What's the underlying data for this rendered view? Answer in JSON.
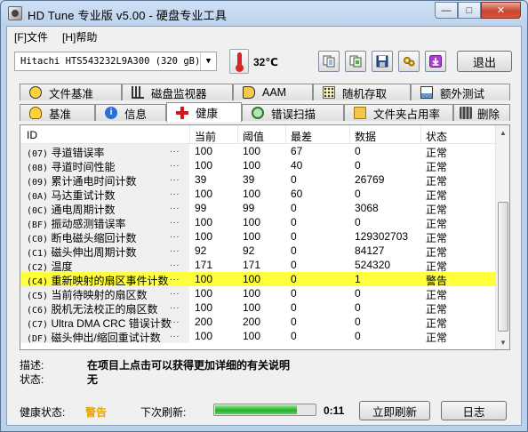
{
  "window": {
    "title": "HD Tune 专业版 v5.00 - 硬盘专业工具",
    "min": "—",
    "max": "□",
    "close": "✕"
  },
  "menu": [
    {
      "label": "[F]文件"
    },
    {
      "label": "[H]帮助"
    }
  ],
  "toolbar": {
    "drive": "Hitachi HTS543232L9A300 (320 gB)",
    "temperature": "32℃",
    "exit_label": "退出",
    "icons": [
      "copy-text-icon",
      "copy-screenshot-icon",
      "save-icon",
      "options-icon",
      "download-icon"
    ]
  },
  "tabs_top": [
    {
      "label": "文件基准",
      "icon": "file-benchmark-icon"
    },
    {
      "label": "磁盘监视器",
      "icon": "disk-monitor-icon"
    },
    {
      "label": "AAM",
      "icon": "speaker-icon"
    },
    {
      "label": "随机存取",
      "icon": "random-access-icon"
    },
    {
      "label": "额外测试",
      "icon": "extra-tests-icon"
    }
  ],
  "tabs_bottom": [
    {
      "label": "基准",
      "icon": "benchmark-icon"
    },
    {
      "label": "信息",
      "icon": "info-icon"
    },
    {
      "label": "健康",
      "icon": "health-icon",
      "active": true
    },
    {
      "label": "错误扫描",
      "icon": "error-scan-icon"
    },
    {
      "label": "文件夹占用率",
      "icon": "folder-usage-icon"
    },
    {
      "label": "删除",
      "icon": "erase-icon"
    }
  ],
  "table": {
    "headers": {
      "id": "ID",
      "current": "当前",
      "threshold": "阈值",
      "worst": "最差",
      "data": "数据",
      "status": "状态"
    },
    "rows": [
      {
        "code": "(07)",
        "name": "寻道错误率",
        "current": "100",
        "threshold": "100",
        "worst": "67",
        "data": "0",
        "status": "正常"
      },
      {
        "code": "(08)",
        "name": "寻道时间性能",
        "current": "100",
        "threshold": "100",
        "worst": "40",
        "data": "0",
        "status": "正常"
      },
      {
        "code": "(09)",
        "name": "累计通电时间计数",
        "current": "39",
        "threshold": "39",
        "worst": "0",
        "data": "26769",
        "status": "正常"
      },
      {
        "code": "(0A)",
        "name": "马达重试计数",
        "current": "100",
        "threshold": "100",
        "worst": "60",
        "data": "0",
        "status": "正常"
      },
      {
        "code": "(0C)",
        "name": "通电周期计数",
        "current": "99",
        "threshold": "99",
        "worst": "0",
        "data": "3068",
        "status": "正常"
      },
      {
        "code": "(BF)",
        "name": "振动感测错误率",
        "current": "100",
        "threshold": "100",
        "worst": "0",
        "data": "0",
        "status": "正常"
      },
      {
        "code": "(C0)",
        "name": "断电磁头缩回计数",
        "current": "100",
        "threshold": "100",
        "worst": "0",
        "data": "129302703",
        "status": "正常"
      },
      {
        "code": "(C1)",
        "name": "磁头伸出周期计数",
        "current": "92",
        "threshold": "92",
        "worst": "0",
        "data": "84127",
        "status": "正常"
      },
      {
        "code": "(C2)",
        "name": "温度",
        "current": "171",
        "threshold": "171",
        "worst": "0",
        "data": "524320",
        "status": "正常"
      },
      {
        "code": "(C4)",
        "name": "重新映射的扇区事件计数",
        "current": "100",
        "threshold": "100",
        "worst": "0",
        "data": "1",
        "status": "警告",
        "highlight": true
      },
      {
        "code": "(C5)",
        "name": "当前待映射的扇区数",
        "current": "100",
        "threshold": "100",
        "worst": "0",
        "data": "0",
        "status": "正常"
      },
      {
        "code": "(C6)",
        "name": "脱机无法校正的扇区数",
        "current": "100",
        "threshold": "100",
        "worst": "0",
        "data": "0",
        "status": "正常"
      },
      {
        "code": "(C7)",
        "name": "Ultra DMA CRC 错误计数",
        "current": "200",
        "threshold": "200",
        "worst": "0",
        "data": "0",
        "status": "正常"
      },
      {
        "code": "(DF)",
        "name": "磁头伸出/缩回重试计数",
        "current": "100",
        "threshold": "100",
        "worst": "0",
        "data": "0",
        "status": "正常"
      }
    ]
  },
  "description": {
    "desc_label": "描述:",
    "desc_value": "在项目上点击可以获得更加详细的有关说明",
    "status_label": "状态:",
    "status_value": "无"
  },
  "footer": {
    "health_label": "健康状态:",
    "health_value": "警告",
    "next_refresh_label": "下次刷新:",
    "refresh_progress": 0.82,
    "countdown": "0:11",
    "refresh_now_label": "立即刷新",
    "log_label": "日志"
  },
  "colors": {
    "warning_text": "#e6a800",
    "highlight_row": "#ffff3c",
    "progress": "#1fb31f"
  }
}
